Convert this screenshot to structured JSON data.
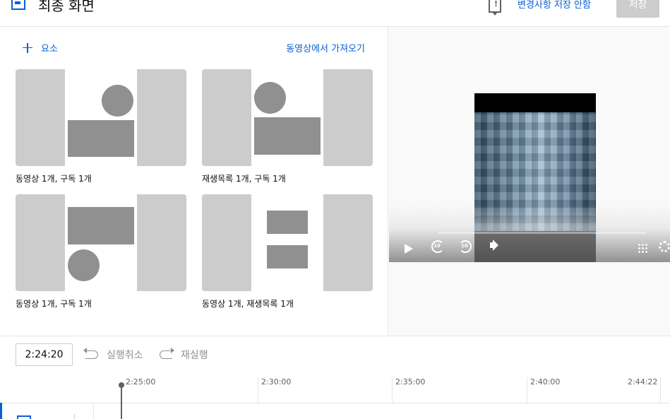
{
  "header": {
    "title": "최종 화면",
    "discard_label": "변경사항 저장 안함",
    "save_label": "저장"
  },
  "left_panel": {
    "add_element_label": "요소",
    "import_label": "동영상에서 가져오기",
    "templates": [
      {
        "label": "동영상 1개, 구독 1개"
      },
      {
        "label": "재생목록 1개, 구독 1개"
      },
      {
        "label": "동영상 1개, 구독 1개"
      },
      {
        "label": "동영상 1개, 재생목록 1개"
      }
    ]
  },
  "player": {
    "rewind_label": "10",
    "forward_label": "10"
  },
  "timeline": {
    "current_time": "2:24:20",
    "undo_label": "실행취소",
    "redo_label": "재실행",
    "ticks": [
      "2:25:00",
      "2:30:00",
      "2:35:00",
      "2:40:00",
      "2:44:22"
    ]
  },
  "colors": {
    "accent": "#065fd4",
    "template_bg": "#cccccc",
    "template_shape": "#909090"
  }
}
